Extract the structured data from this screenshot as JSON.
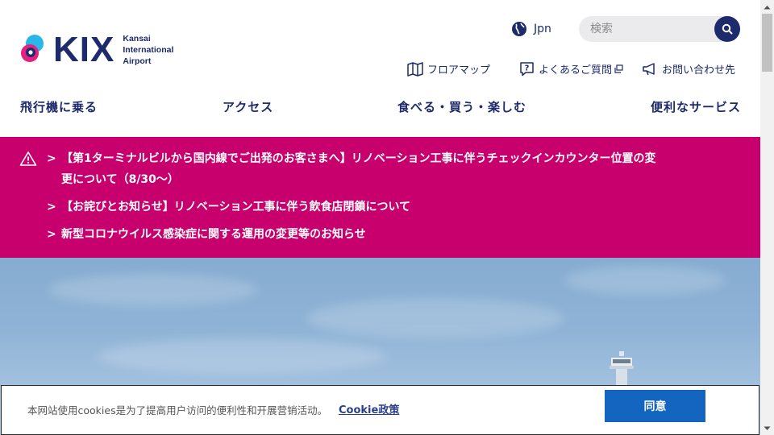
{
  "header": {
    "logo": {
      "wordmark": "KIX",
      "sub_lines": [
        "Kansai",
        "International",
        "Airport"
      ]
    },
    "language": {
      "label": "Jpn",
      "icon": "globe-icon"
    },
    "search": {
      "placeholder": "検索",
      "icon": "search-icon"
    },
    "utility_links": [
      {
        "label": "フロアマップ",
        "icon": "map-icon"
      },
      {
        "label": "よくあるご質問",
        "icon": "question-icon",
        "external_icon": "external-link-icon"
      },
      {
        "label": "お問い合わせ先",
        "icon": "megaphone-icon"
      }
    ],
    "nav": [
      {
        "label": "飛行機に乗る"
      },
      {
        "label": "アクセス"
      },
      {
        "label": "食べる・買う・楽しむ"
      },
      {
        "label": "便利なサービス"
      }
    ]
  },
  "alerts": {
    "icon": "warning-icon",
    "items": [
      {
        "line1": "【第1ターミナルビルから国内線でご出発のお客さまへ】リノベーション工事に伴うチェックインカウンター位置の変",
        "line2": "更について（8/30〜）"
      },
      {
        "line1": "【お詫びとお知らせ】リノベーション工事に伴う飲食店閉鎖について"
      },
      {
        "line1": "新型コロナウイルス感染症に関する運用の変更等のお知らせ"
      }
    ],
    "chevron": ">"
  },
  "cookie": {
    "text": "本网站使用cookies是为了提高用户访问的便利性和开展营销活动。",
    "link": "Cookie政策",
    "button": "同意"
  },
  "colors": {
    "brand_navy": "#1d2a6b",
    "alert_magenta": "#c8006e",
    "accept_blue": "#1465c0"
  }
}
